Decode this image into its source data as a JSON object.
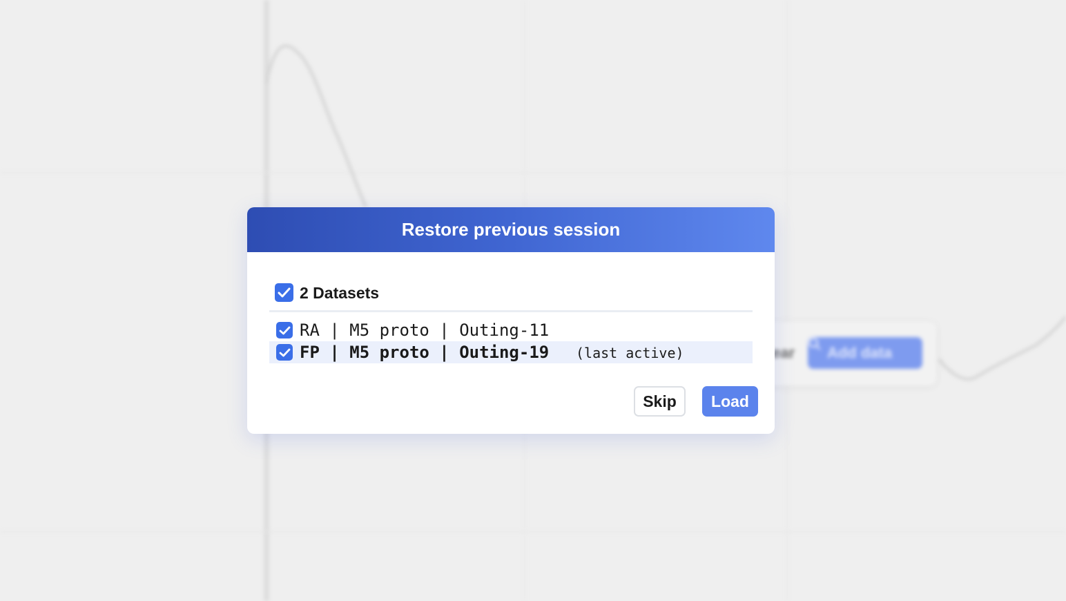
{
  "background": {
    "add_data_label": "Add data",
    "add_data_icon": "search-icon",
    "clear_label": "lear"
  },
  "dialog": {
    "title": "Restore previous session",
    "group": {
      "label": "2 Datasets",
      "checked": true
    },
    "datasets": [
      {
        "label": "RA | M5 proto | Outing-11",
        "checked": true,
        "suffix": ""
      },
      {
        "label": "FP | M5 proto | Outing-19",
        "checked": true,
        "suffix": "(last active)"
      }
    ],
    "buttons": {
      "skip": "Skip",
      "load": "Load"
    }
  },
  "colors": {
    "header_start": "#2e4db3",
    "header_end": "#5f88ee",
    "checkbox": "#3a6ee8",
    "primary_button": "#5b83ec",
    "active_row": "#ebf0fc"
  }
}
